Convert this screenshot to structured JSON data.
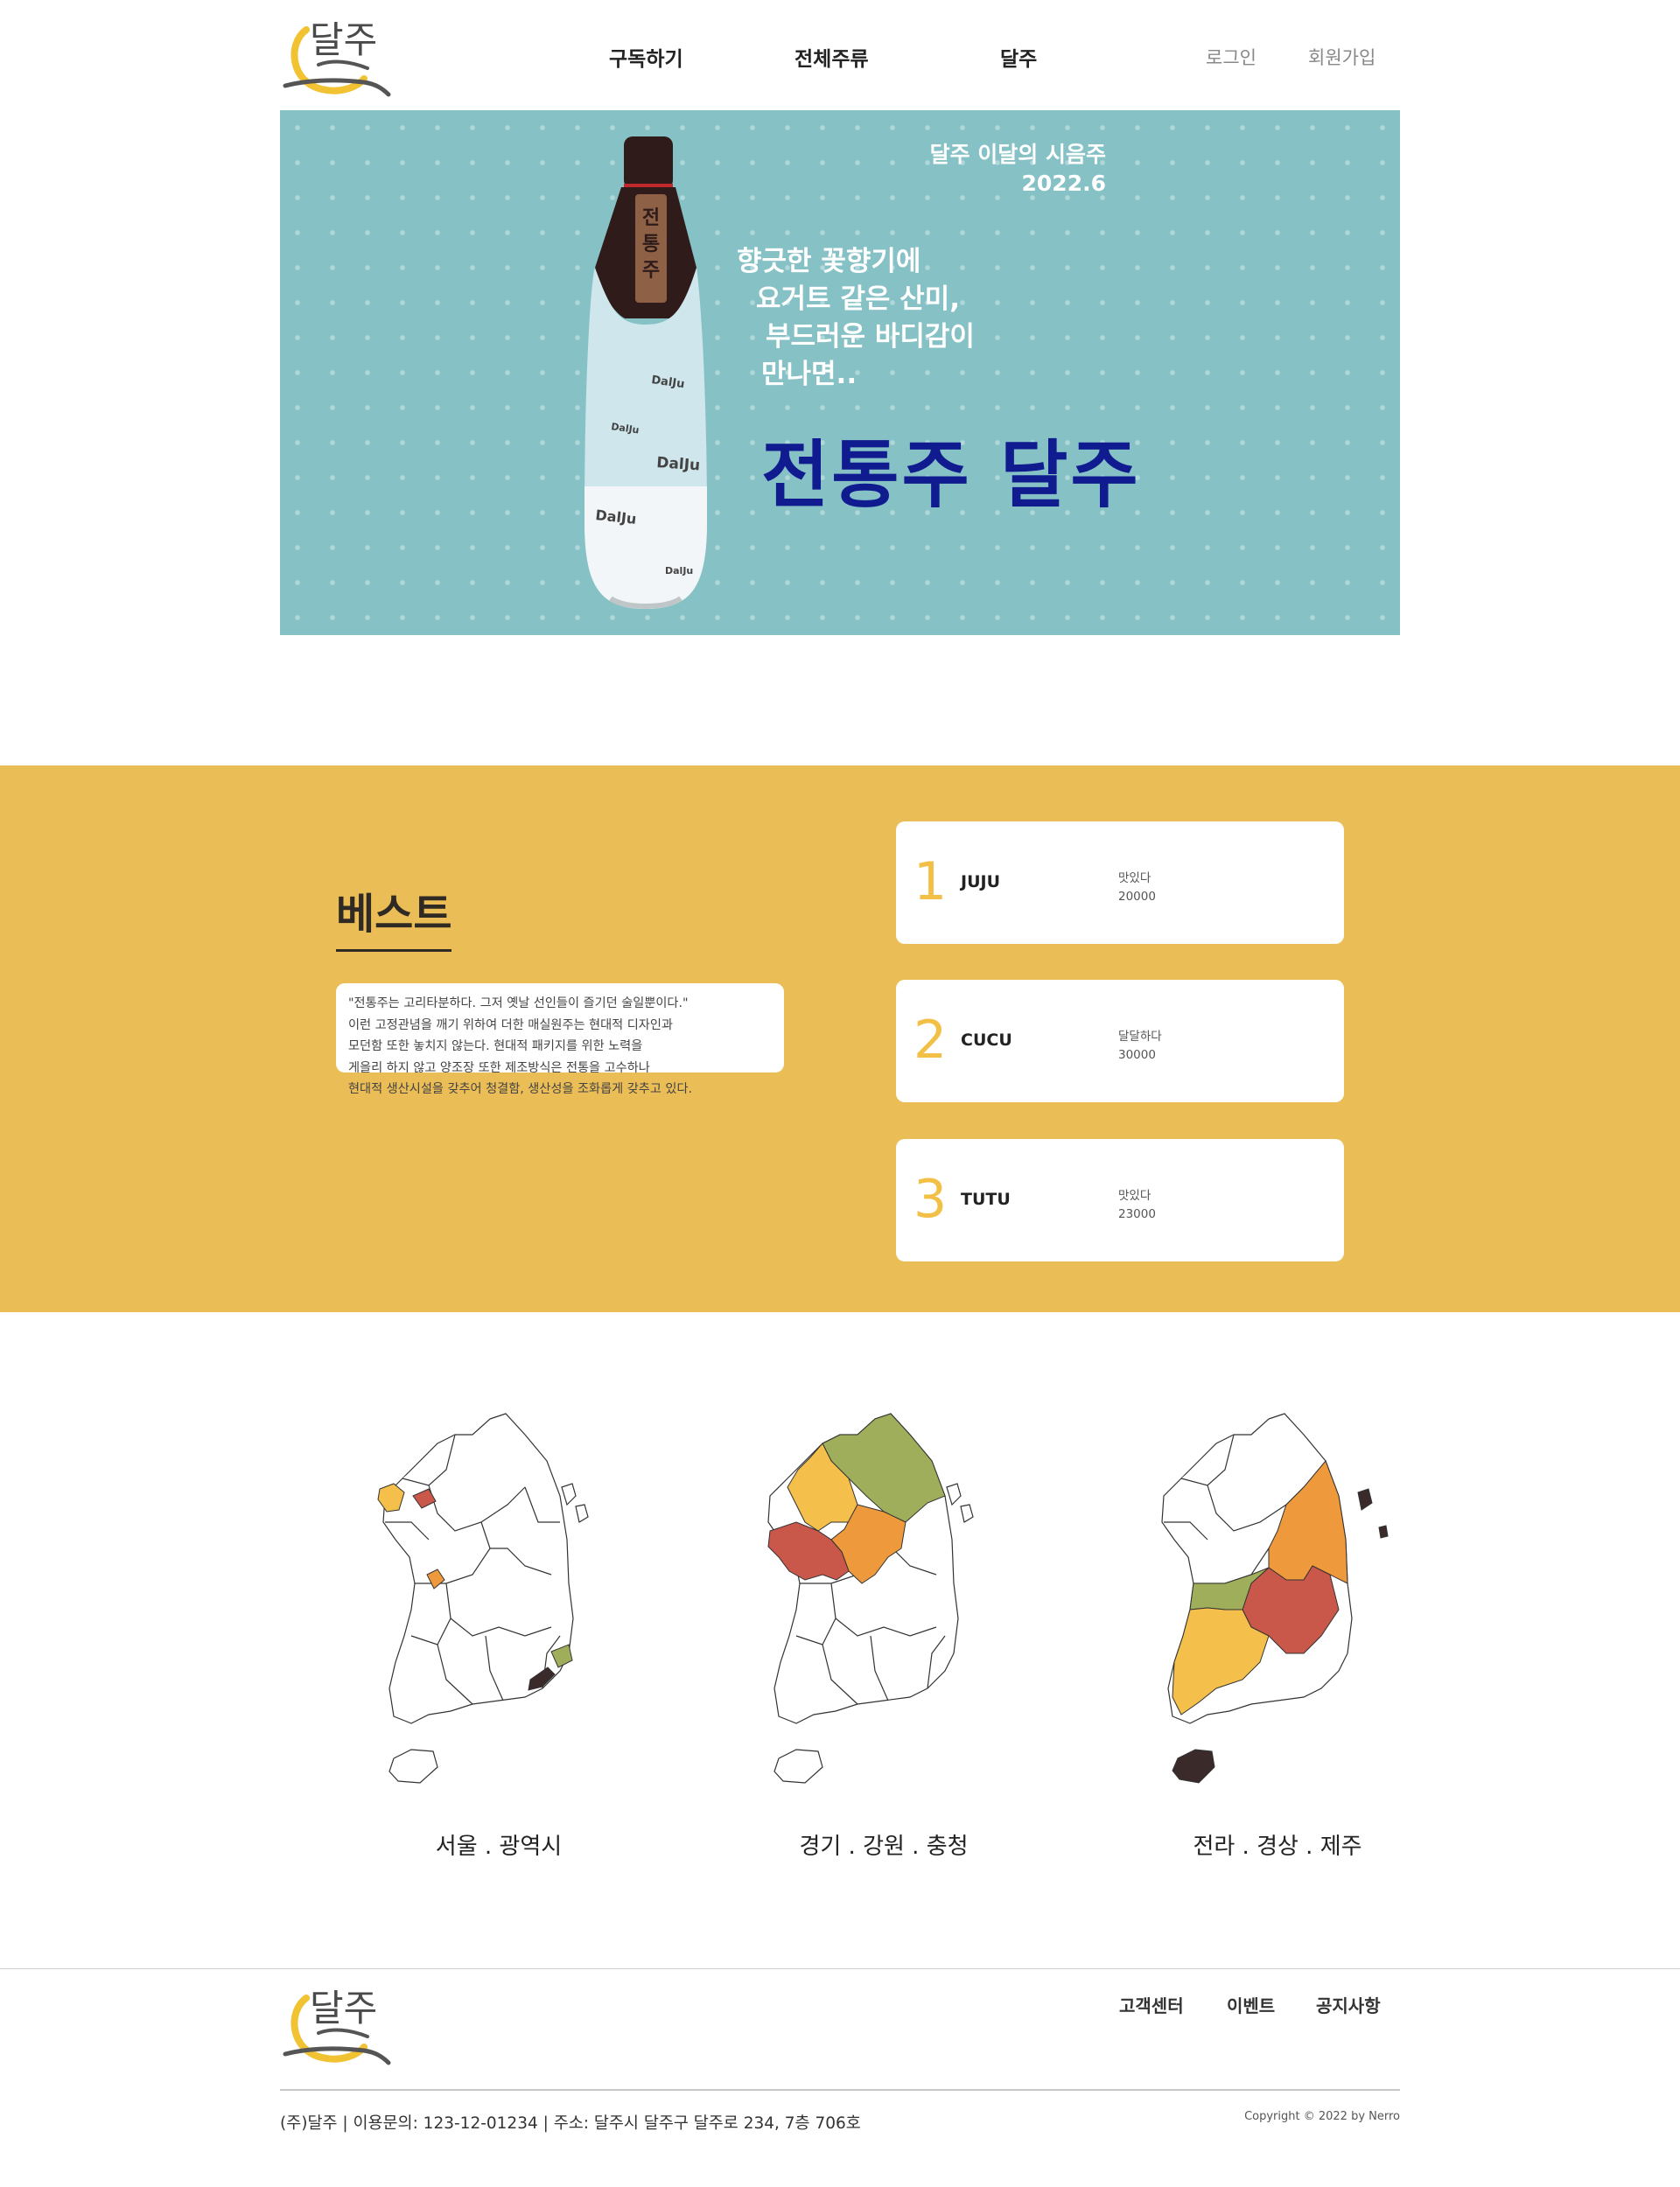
{
  "header": {
    "logo_text": "달주",
    "nav": [
      {
        "label": "구독하기"
      },
      {
        "label": "전체주류"
      },
      {
        "label": "달주"
      }
    ],
    "auth": {
      "login": "로그인",
      "signup": "회원가입"
    }
  },
  "hero": {
    "meta_title": "달주 이달의 시음주",
    "meta_date": "2022.6",
    "copy": [
      "향긋한 꽃향기에",
      "요거트 같은 산미,",
      "부드러운 바디감이",
      "만나면.."
    ],
    "brand": "전통주 달주",
    "bottle_tag": "전통주",
    "bottle_label": "DalJu"
  },
  "best": {
    "title": "베스트",
    "description": [
      "\"전통주는 고리타분하다. 그저 옛날 선인들이 즐기던 술일뿐이다.\"",
      "이런 고정관념을 깨기 위하여 더한 매실원주는 현대적 디자인과",
      "모던함 또한 놓치지 않는다. 현대적 패키지를 위한 노력을",
      "게을리 하지 않고 양조장 또한 제조방식은 전통을 고수하나",
      "현대적 생산시설을 갖추어 청결함, 생산성을 조화롭게 갖추고 있다."
    ],
    "items": [
      {
        "rank": "1",
        "name": "JUJU",
        "taste": "맛있다",
        "price": "20000"
      },
      {
        "rank": "2",
        "name": "CUCU",
        "taste": "달달하다",
        "price": "30000"
      },
      {
        "rank": "3",
        "name": "TUTU",
        "taste": "맛있다",
        "price": "23000"
      }
    ]
  },
  "regions": [
    {
      "label": "서울 . 광역시"
    },
    {
      "label": "경기 . 강원 . 충청"
    },
    {
      "label": "전라 . 경상 . 제주"
    }
  ],
  "colors": {
    "accent_yellow": "#ebbd57",
    "hero_bg": "#86c1c6",
    "brand_navy": "#0f1b8f",
    "map_yellow": "#f4c04b",
    "map_red": "#c9574a",
    "map_orange": "#ee9a3c",
    "map_green": "#9fae5a",
    "map_dark": "#3a2a2a"
  },
  "footer": {
    "links": [
      "고객센터",
      "이벤트",
      "공지사항"
    ],
    "company": "(주)달주 | 이용문의: 123-12-01234 | 주소: 달주시 달주구 달주로 234, 7층 706호",
    "copyright": "Copyright © 2022 by Nerro"
  }
}
